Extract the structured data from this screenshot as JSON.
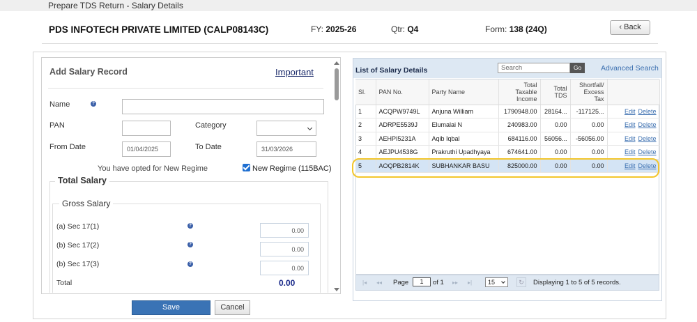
{
  "window": {
    "title": "Prepare TDS Return - Salary Details"
  },
  "header": {
    "company": "PDS INFOTECH PRIVATE LIMITED (CALP08143C)",
    "fy_label": "FY:",
    "fy_value": "2025-26",
    "qtr_label": "Qtr:",
    "qtr_value": "Q4",
    "form_label": "Form:",
    "form_value": "138 (24Q)",
    "back_label": "Back",
    "back_icon": "chevron-left-icon"
  },
  "form": {
    "title": "Add Salary Record",
    "important_link": "Important",
    "name_label": "Name",
    "name_value": "",
    "pan_label": "PAN",
    "pan_value": "",
    "category_label": "Category",
    "category_value": "",
    "from_date_label": "From Date",
    "from_date_value": "01/04/2025",
    "to_date_label": "To Date",
    "to_date_value": "31/03/2026",
    "regime_note": "You have opted for New Regime",
    "regime_checkbox_label": "New Regime (115BAC)",
    "regime_checked": true,
    "total_salary_legend": "Total Salary",
    "gross_salary_legend": "Gross Salary",
    "sec_a_label": "(a) Sec 17(1)",
    "sec_a_value": "0.00",
    "sec_b_label": "(b) Sec 17(2)",
    "sec_b_value": "0.00",
    "sec_c_label": "(b) Sec 17(3)",
    "sec_c_value": "0.00",
    "total_label": "Total",
    "total_value": "0.00",
    "save_label": "Save",
    "cancel_label": "Cancel"
  },
  "list": {
    "title": "List of Salary Details",
    "search_placeholder": "Search",
    "go_label": "Go",
    "advanced_search": "Advanced Search",
    "columns": {
      "sl": "Sl.",
      "pan": "PAN No.",
      "party": "Party Name",
      "income_1": "Total",
      "income_2": "Taxable",
      "income_3": "Income",
      "tds_1": "Total",
      "tds_2": "TDS",
      "short_1": "Shortfall/",
      "short_2": "Excess",
      "short_3": "Tax"
    },
    "edit_label": "Edit",
    "delete_label": "Delete",
    "rows": [
      {
        "sl": "1",
        "pan": "ACQPW9749L",
        "party": "Anjuna William",
        "income": "1790948.00",
        "tds": "28164...",
        "shortfall": "-117125..."
      },
      {
        "sl": "2",
        "pan": "ADRPE5539J",
        "party": "Elumalai N",
        "income": "240983.00",
        "tds": "0.00",
        "shortfall": "0.00"
      },
      {
        "sl": "3",
        "pan": "AEHPI5231A",
        "party": "Aqib Iqbal",
        "income": "684116.00",
        "tds": "56056...",
        "shortfall": "-56056.00"
      },
      {
        "sl": "4",
        "pan": "AEJPU4538G",
        "party": "Prakruthi Upadhyaya",
        "income": "674641.00",
        "tds": "0.00",
        "shortfall": "0.00"
      },
      {
        "sl": "5",
        "pan": "AOQPB2814K",
        "party": "SUBHANKAR BASU",
        "income": "825000.00",
        "tds": "0.00",
        "shortfall": "0.00"
      }
    ],
    "selected_row": 5
  },
  "pager": {
    "page_label": "Page",
    "page_value": "1",
    "of_label": "of 1",
    "page_size": "15",
    "summary": "Displaying 1 to 5 of 5 records."
  }
}
